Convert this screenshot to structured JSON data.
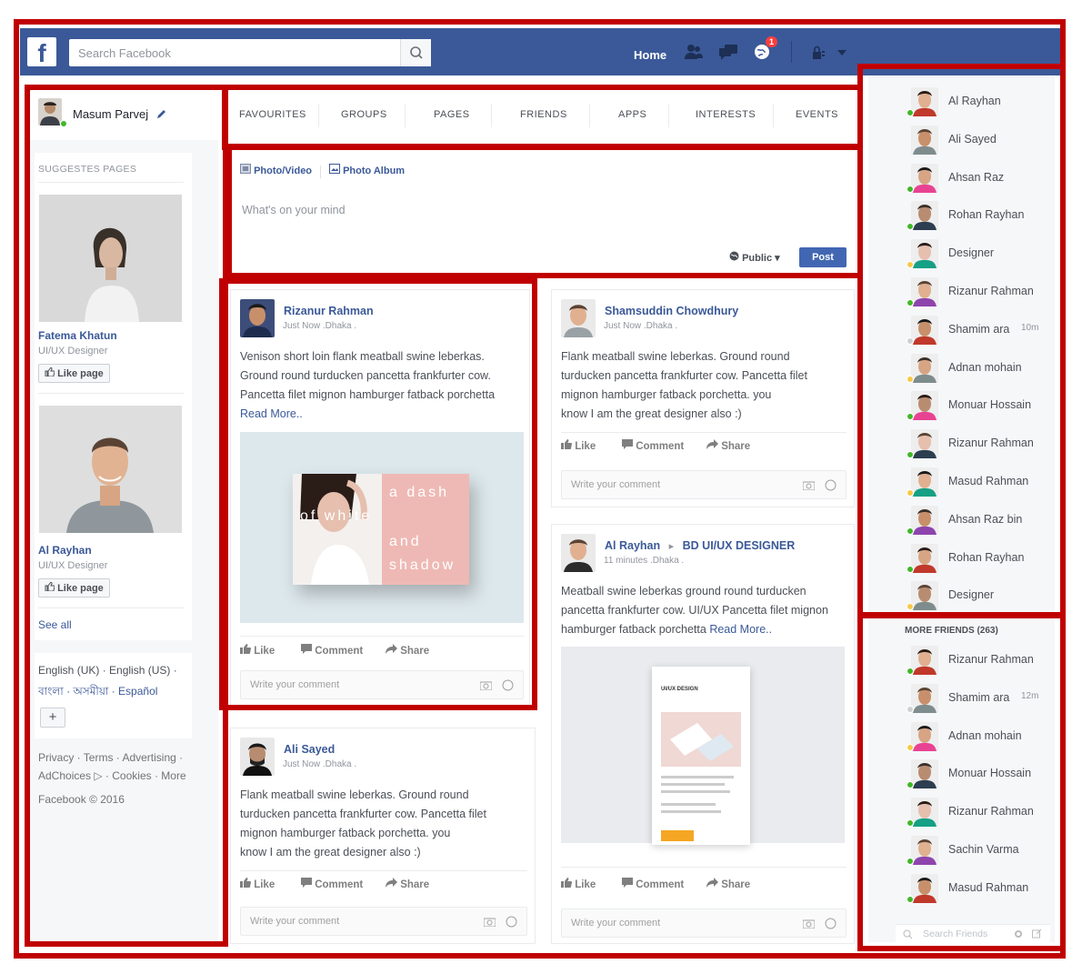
{
  "topbar": {
    "logo_letter": "f",
    "search_placeholder": "Search Facebook",
    "home_label": "Home",
    "notification_count": "1",
    "brand_color": "#3b5998"
  },
  "profile": {
    "name": "Masum Parvej"
  },
  "suggested": {
    "heading": "SUGGESTES PAGES",
    "pages": [
      {
        "name": "Fatema Khatun",
        "role": "UI/UX Designer",
        "like_label": "Like page"
      },
      {
        "name": "Al Rayhan",
        "role": "UI/UX Designer",
        "like_label": "Like page"
      }
    ],
    "see_all": "See all"
  },
  "languages": {
    "line1": "English (UK) · English (US) ·",
    "line2": "বাংলা · অসমীয়া · Español",
    "add_label": "+"
  },
  "footer": {
    "line1": "Privacy · Terms · Advertising ·",
    "line2": "AdChoices ▷ · Cookies · More",
    "copyright": "Facebook © 2016"
  },
  "tabs": [
    "FAVOURITES",
    "GROUPS",
    "PAGES",
    "FRIENDS",
    "APPS",
    "INTERESTS",
    "EVENTS"
  ],
  "composer": {
    "photo_video": "Photo/Video",
    "photo_album": "Photo Album",
    "placeholder": "What's on your mind",
    "audience": "Public ▾",
    "post_label": "Post"
  },
  "actions": {
    "like": "Like",
    "comment": "Comment",
    "share": "Share",
    "comment_placeholder": "Write your comment"
  },
  "posts": [
    {
      "author": "Rizanur Rahman",
      "meta": "Just Now .Dhaka .",
      "text": [
        "Venison short loin flank meatball swine leberkas.",
        "Ground round turducken pancetta frankfurter cow.",
        "Pancetta filet mignon hamburger fatback porchetta"
      ],
      "read_more": "Read More..",
      "image_words": [
        "a dash",
        "of white",
        "and",
        "shadow"
      ]
    },
    {
      "author": "Ali Sayed",
      "meta": "Just Now .Dhaka .",
      "text": [
        "Flank meatball swine leberkas. Ground round",
        "turducken pancetta frankfurter cow. Pancetta filet",
        "mignon hamburger fatback porchetta. you",
        "know I am the great designer also :)"
      ]
    },
    {
      "author": "Shamsuddin Chowdhury",
      "meta": "Just Now .Dhaka .",
      "text": [
        "Flank meatball swine leberkas. Ground round",
        "turducken pancetta frankfurter cow. Pancetta filet",
        "mignon hamburger fatback porchetta. you",
        "know I am the great designer also :)"
      ]
    },
    {
      "author": "Al Rayhan",
      "arrow": "▸",
      "group": "BD UI/UX DESIGNER",
      "meta": "11 minutes .Dhaka .",
      "text": [
        "Meatball swine leberkas ground round turducken",
        "pancetta frankfurter cow. UI/UX Pancetta filet mignon",
        "hamburger fatback porchetta"
      ],
      "read_more": "Read More..",
      "mock_title": "UI/UX DESIGN"
    }
  ],
  "online": [
    {
      "name": "Al Rayhan",
      "status": "green"
    },
    {
      "name": "Ali Sayed",
      "status": "none"
    },
    {
      "name": "Ahsan Raz",
      "status": "green"
    },
    {
      "name": "Rohan Rayhan",
      "status": "green"
    },
    {
      "name": "Designer",
      "status": "yellow"
    },
    {
      "name": "Rizanur Rahman",
      "status": "green"
    },
    {
      "name": "Shamim ara",
      "status": "grey",
      "time": "10m"
    },
    {
      "name": "Adnan mohain",
      "status": "yellow"
    },
    {
      "name": "Monuar Hossain",
      "status": "green"
    },
    {
      "name": "Rizanur Rahman",
      "status": "green"
    },
    {
      "name": "Masud Rahman",
      "status": "yellow"
    },
    {
      "name": "Ahsan Raz bin",
      "status": "green"
    },
    {
      "name": "Rohan Rayhan",
      "status": "green"
    },
    {
      "name": "Designer",
      "status": "yellow"
    }
  ],
  "more_friends": {
    "heading": "MORE FRIENDS (263)",
    "list": [
      {
        "name": "Rizanur Rahman",
        "status": "green"
      },
      {
        "name": "Shamim ara",
        "status": "grey",
        "time": "12m"
      },
      {
        "name": "Adnan mohain",
        "status": "yellow"
      },
      {
        "name": "Monuar Hossain",
        "status": "green"
      },
      {
        "name": "Rizanur Rahman",
        "status": "green"
      },
      {
        "name": "Sachin Varma",
        "status": "green"
      },
      {
        "name": "Masud Rahman",
        "status": "green"
      }
    ],
    "search_placeholder": "Search Friends"
  }
}
